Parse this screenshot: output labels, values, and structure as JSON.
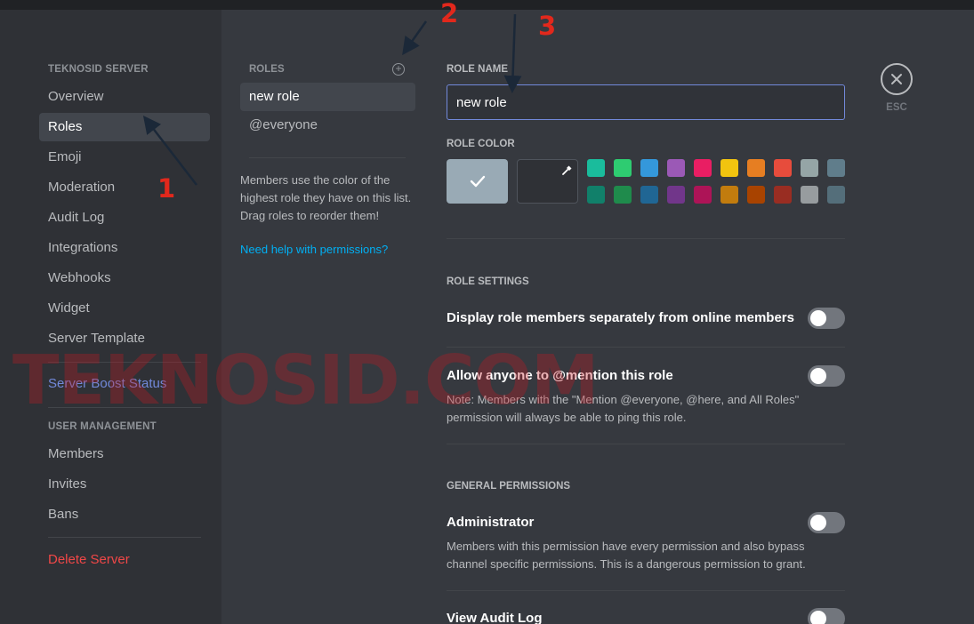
{
  "sidebar": {
    "server_section": "TEKNOSID SERVER",
    "items": [
      {
        "label": "Overview"
      },
      {
        "label": "Roles"
      },
      {
        "label": "Emoji"
      },
      {
        "label": "Moderation"
      },
      {
        "label": "Audit Log"
      },
      {
        "label": "Integrations"
      },
      {
        "label": "Webhooks"
      },
      {
        "label": "Widget"
      },
      {
        "label": "Server Template"
      }
    ],
    "boost_status": "Server Boost Status",
    "user_section": "USER MANAGEMENT",
    "user_items": [
      {
        "label": "Members"
      },
      {
        "label": "Invites"
      },
      {
        "label": "Bans"
      }
    ],
    "delete_server": "Delete Server"
  },
  "roles": {
    "header": "ROLES",
    "add_icon": "plus-circle-icon",
    "items": [
      {
        "label": "new role"
      },
      {
        "label": "@everyone"
      }
    ],
    "description": "Members use the color of the highest role they have on this list. Drag roles to reorder them!",
    "help_link": "Need help with permissions?"
  },
  "main": {
    "role_name_label": "ROLE NAME",
    "role_name_value": "new role",
    "role_color_label": "ROLE COLOR",
    "color_swatches": [
      "#1abc9c",
      "#2ecc71",
      "#3498db",
      "#9b59b6",
      "#e91e63",
      "#f1c40f",
      "#e67e22",
      "#e74c3c",
      "#95a5a6",
      "#607d8b",
      "#11806a",
      "#1f8b4c",
      "#206694",
      "#71368a",
      "#ad1457",
      "#c27c0e",
      "#a84300",
      "#992d22",
      "#979c9f",
      "#546e7a"
    ],
    "default_color": "#99aab5",
    "role_settings_label": "ROLE SETTINGS",
    "setting_display_separately": "Display role members separately from online members",
    "setting_mention_prefix": "Allow anyone to ",
    "setting_mention_bold": "@mention",
    "setting_mention_suffix": " this role",
    "setting_mention_note": "Note: Members with the \"Mention @everyone, @here, and All Roles\" permission will always be able to ping this role.",
    "general_permissions_label": "GENERAL PERMISSIONS",
    "perm_admin_title": "Administrator",
    "perm_admin_desc": "Members with this permission have every permission and also bypass channel specific permissions. This is a dangerous permission to grant.",
    "perm_audit_title": "View Audit Log",
    "toggles": {
      "display_separately": false,
      "mention": false,
      "administrator": false,
      "view_audit_log": false
    }
  },
  "close": {
    "icon": "close-icon",
    "label": "ESC"
  },
  "overlay": {
    "watermark": "TEKNOSID.COM",
    "annotations": [
      "1",
      "2",
      "3"
    ],
    "annotation_color": "#e2281c"
  }
}
